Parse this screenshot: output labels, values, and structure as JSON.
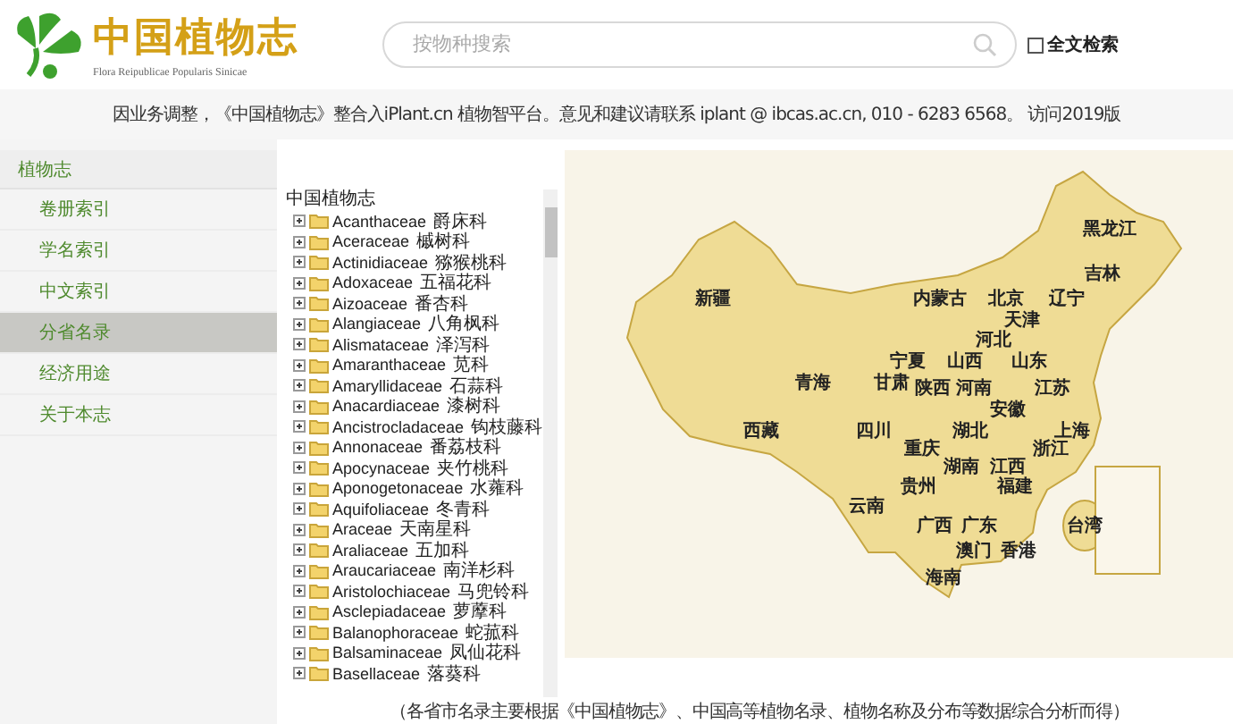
{
  "header": {
    "title": "中国植物志",
    "subtitle": "Flora Reipublicae Popularis Sinicae",
    "search": {
      "placeholder": "按物种搜索"
    },
    "fulltext": {
      "label": "全文检索",
      "checked": false
    }
  },
  "notice": "因业务调整，《中国植物志》整合入iPlant.cn 植物智平台。意见和建议请联系 iplant @ ibcas.ac.cn, 010 - 6283 6568。 访问2019版",
  "sidebar": {
    "title": "植物志",
    "items": [
      {
        "label": "卷册索引",
        "selected": false
      },
      {
        "label": "学名索引",
        "selected": false
      },
      {
        "label": "中文索引",
        "selected": false
      },
      {
        "label": "分省名录",
        "selected": true
      },
      {
        "label": "经济用途",
        "selected": false
      },
      {
        "label": "关于本志",
        "selected": false
      }
    ]
  },
  "tree": {
    "root": "中国植物志",
    "items": [
      {
        "name": "Acanthaceae",
        "cn": "爵床科"
      },
      {
        "name": "Aceraceae",
        "cn": "槭树科"
      },
      {
        "name": "Actinidiaceae",
        "cn": "猕猴桃科"
      },
      {
        "name": "Adoxaceae",
        "cn": "五福花科"
      },
      {
        "name": "Aizoaceae",
        "cn": "番杏科"
      },
      {
        "name": "Alangiaceae",
        "cn": "八角枫科"
      },
      {
        "name": "Alismataceae",
        "cn": "泽泻科"
      },
      {
        "name": "Amaranthaceae",
        "cn": "苋科"
      },
      {
        "name": "Amaryllidaceae",
        "cn": "石蒜科"
      },
      {
        "name": "Anacardiaceae",
        "cn": "漆树科"
      },
      {
        "name": "Ancistrocladaceae",
        "cn": "钩枝藤科"
      },
      {
        "name": "Annonaceae",
        "cn": "番荔枝科"
      },
      {
        "name": "Apocynaceae",
        "cn": "夹竹桃科"
      },
      {
        "name": "Aponogetonaceae",
        "cn": "水蕹科"
      },
      {
        "name": "Aquifoliaceae",
        "cn": "冬青科"
      },
      {
        "name": "Araceae",
        "cn": "天南星科"
      },
      {
        "name": "Araliaceae",
        "cn": "五加科"
      },
      {
        "name": "Araucariaceae",
        "cn": "南洋杉科"
      },
      {
        "name": "Aristolochiaceae",
        "cn": "马兜铃科"
      },
      {
        "name": "Asclepiadaceae",
        "cn": "萝藦科"
      },
      {
        "name": "Balanophoraceae",
        "cn": "蛇菰科"
      },
      {
        "name": "Balsaminaceae",
        "cn": "凤仙花科"
      },
      {
        "name": "Basellaceae",
        "cn": "落葵科"
      }
    ]
  },
  "map": {
    "provinces": [
      "黑龙江",
      "吉林",
      "新疆",
      "内蒙古",
      "北京",
      "辽宁",
      "天津",
      "河北",
      "宁夏",
      "山西",
      "山东",
      "青海",
      "甘肃",
      "陕西",
      "河南",
      "江苏",
      "安徽",
      "西藏",
      "四川",
      "湖北",
      "上海",
      "重庆",
      "浙江",
      "湖南",
      "江西",
      "贵州",
      "福建",
      "云南",
      "广西",
      "广东",
      "台湾",
      "澳门",
      "香港",
      "海南"
    ],
    "caption": "（各省市名录主要根据《中国植物志》、中国高等植物名录、植物名称及分布等数据综合分析而得）"
  }
}
